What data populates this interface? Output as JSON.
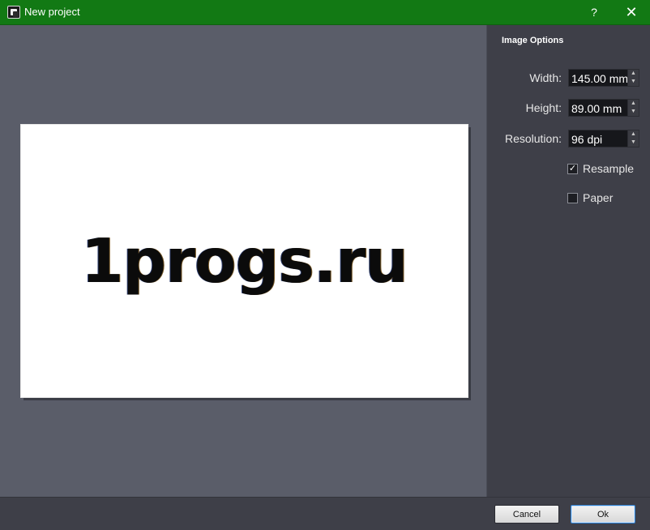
{
  "window": {
    "title": "New project",
    "help_label": "?",
    "close_label": "✕",
    "icon": "app-icon"
  },
  "preview": {
    "watermark": "1progs.ru"
  },
  "options": {
    "title": "Image Options",
    "width": {
      "label": "Width:",
      "value": "145.00 mm"
    },
    "height": {
      "label": "Height:",
      "value": "89.00 mm"
    },
    "resolution": {
      "label": "Resolution:",
      "value": "96 dpi"
    },
    "resample": {
      "label": "Resample",
      "checked": true,
      "mark": "✓"
    },
    "paper": {
      "label": "Paper",
      "checked": false,
      "mark": ""
    }
  },
  "footer": {
    "cancel_label": "Cancel",
    "ok_label": "Ok"
  },
  "colors": {
    "titlebar": "#127914",
    "panel": "#3e3f48",
    "preview_bg": "#5a5d69",
    "canvas": "#ffffff",
    "accent_focus": "#2d7fd1"
  }
}
